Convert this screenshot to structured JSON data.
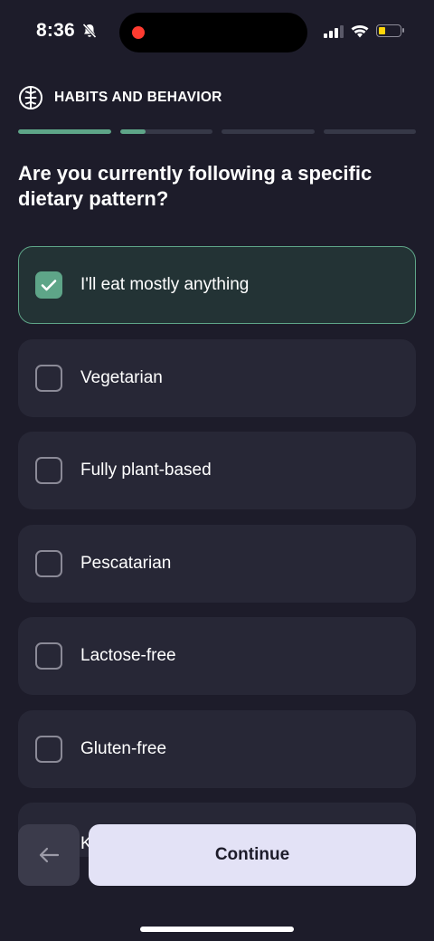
{
  "status_bar": {
    "time": "8:36",
    "icons": [
      "bell-slash-icon",
      "recording-dot-icon",
      "signal-icon",
      "wifi-icon",
      "battery-icon"
    ],
    "battery_color": "#ffd60a",
    "recording_color": "#ff3b30"
  },
  "header": {
    "icon": "brain-icon",
    "title": "HABITS AND BEHAVIOR"
  },
  "progress": {
    "segments": 4,
    "segment_fill": [
      1,
      0.28,
      0,
      0
    ],
    "fill_color": "#5ea588"
  },
  "question": "Are you currently following a specific dietary pattern?",
  "options": [
    {
      "label": "I'll eat mostly anything",
      "checked": true
    },
    {
      "label": "Vegetarian",
      "checked": false
    },
    {
      "label": "Fully plant-based",
      "checked": false
    },
    {
      "label": "Pescatarian",
      "checked": false
    },
    {
      "label": "Lactose-free",
      "checked": false
    },
    {
      "label": "Gluten-free",
      "checked": false
    },
    {
      "label": "K",
      "checked": false
    }
  ],
  "footer": {
    "back_icon": "arrow-left-icon",
    "continue_label": "Continue"
  },
  "colors": {
    "background": "#1d1c2a",
    "card": "#272736",
    "selected_card": "#233335",
    "accent": "#5ea588",
    "continue_bg": "#e3e2f6"
  }
}
